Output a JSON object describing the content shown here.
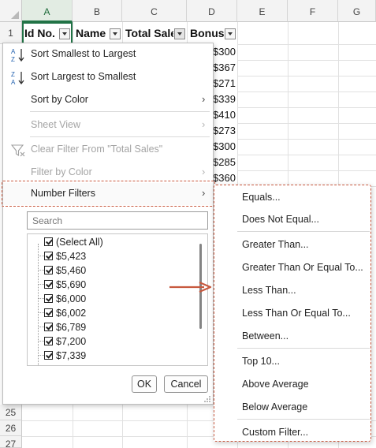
{
  "sheet": {
    "columns": [
      "A",
      "B",
      "C",
      "D",
      "E",
      "F",
      "G"
    ],
    "rows_top": [
      "1"
    ],
    "rows_bottom": [
      "25",
      "26",
      "27"
    ],
    "headers": {
      "id": "Id No.",
      "name": "Name",
      "total_sales": "Total Sales",
      "bonus": "Bonus"
    },
    "bonus_values": [
      "$300",
      "$367",
      "$271",
      "$339",
      "$410",
      "$273",
      "$300",
      "$285",
      "$360"
    ]
  },
  "menu": {
    "sort_asc": "Sort Smallest to Largest",
    "sort_desc": "Sort Largest to Smallest",
    "sort_by_color": "Sort by Color",
    "sheet_view": "Sheet View",
    "clear_filter": "Clear Filter From \"Total Sales\"",
    "filter_by_color": "Filter by Color",
    "number_filters": "Number Filters",
    "search_placeholder": "Search",
    "items": [
      "(Select All)",
      "$5,423",
      "$5,460",
      "$5,690",
      "$6,000",
      "$6,002",
      "$6,789",
      "$7,200",
      "$7,339"
    ],
    "ok": "OK",
    "cancel": "Cancel"
  },
  "submenu": {
    "equals": "Equals...",
    "not_equal": "Does Not Equal...",
    "greater": "Greater Than...",
    "greater_eq": "Greater Than Or Equal To...",
    "less": "Less Than...",
    "less_eq": "Less Than Or Equal To...",
    "between": "Between...",
    "top10": "Top 10...",
    "above_avg": "Above Average",
    "below_avg": "Below Average",
    "custom": "Custom Filter..."
  },
  "colors": {
    "highlight_dash": "#c8593f",
    "selected_column": "#217346",
    "disabled_text": "#a4a4a4"
  },
  "icons": [
    "sort-ascending-icon",
    "sort-descending-icon",
    "clear-filter-icon",
    "submenu-arrow-icon",
    "checkbox-icon",
    "arrow-pointer-icon",
    "resize-grip-icon"
  ]
}
